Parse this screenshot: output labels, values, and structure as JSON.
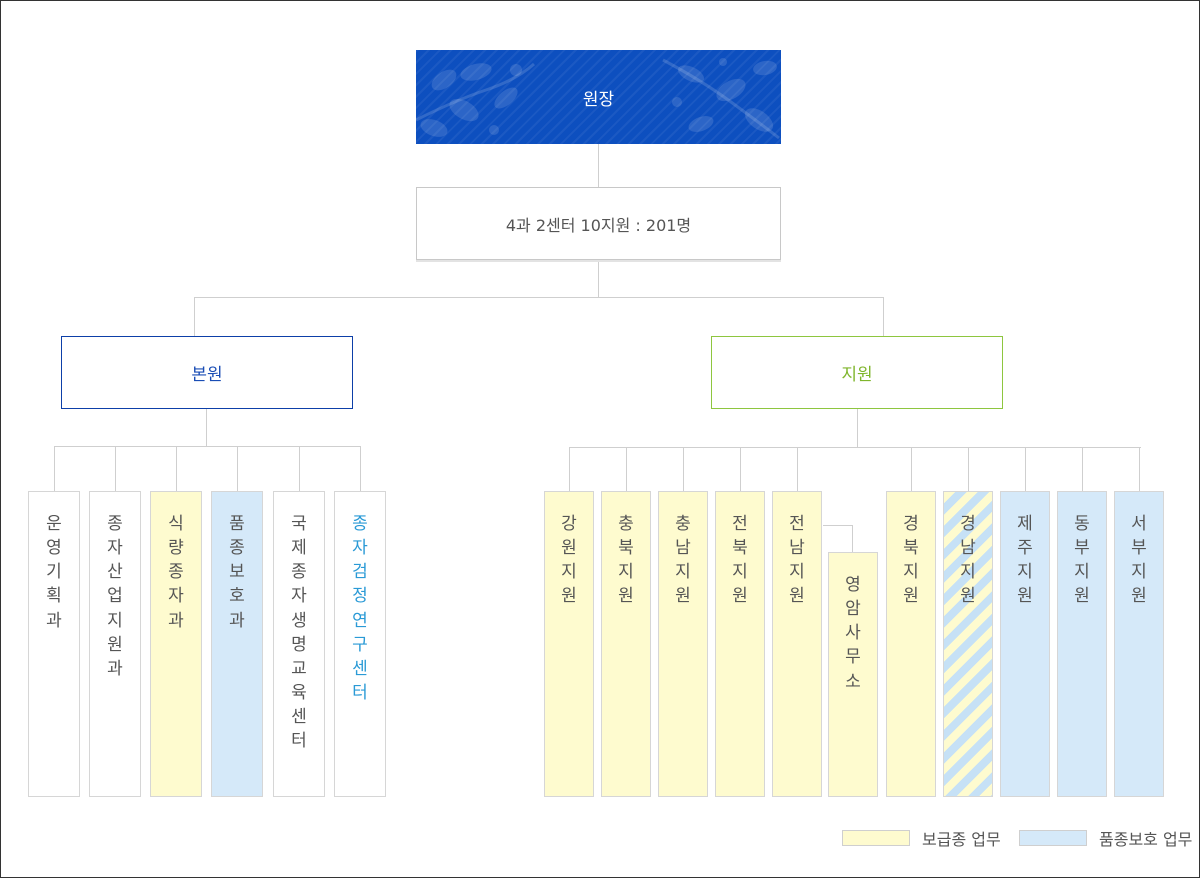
{
  "director": {
    "label": "원장"
  },
  "summary": {
    "label": "4과 2센터 10지원 : 201명"
  },
  "hq": {
    "label": "본원",
    "units": [
      {
        "label": "운영기획과",
        "fill": "none",
        "text": "default"
      },
      {
        "label": "종자산업지원과",
        "fill": "none",
        "text": "default"
      },
      {
        "label": "식량종자과",
        "fill": "yellow",
        "text": "default"
      },
      {
        "label": "품종보호과",
        "fill": "blue",
        "text": "default"
      },
      {
        "label": "국제종자생명교육센터",
        "fill": "none",
        "text": "default"
      },
      {
        "label": "종자검정연구센터",
        "fill": "none",
        "text": "blue"
      }
    ]
  },
  "branches": {
    "label": "지원",
    "units": [
      {
        "label": "강원지원",
        "fill": "yellow"
      },
      {
        "label": "충북지원",
        "fill": "yellow"
      },
      {
        "label": "충남지원",
        "fill": "yellow"
      },
      {
        "label": "전북지원",
        "fill": "yellow"
      },
      {
        "label": "전남지원",
        "fill": "yellow"
      },
      {
        "label": "경북지원",
        "fill": "yellow"
      },
      {
        "label": "경남지원",
        "fill": "stripe"
      },
      {
        "label": "제주지원",
        "fill": "blue"
      },
      {
        "label": "동부지원",
        "fill": "blue"
      },
      {
        "label": "서부지원",
        "fill": "blue"
      }
    ],
    "sub_office": {
      "label": "영암사무소",
      "fill": "yellow",
      "parent": "전남지원"
    }
  },
  "legend": [
    {
      "label": "보급종 업무",
      "color": "#fefbcf"
    },
    {
      "label": "품종보호 업무",
      "color": "#d5e9f9"
    }
  ],
  "colors": {
    "director_bg": "#0d4fbf",
    "hq_border": "#0d3fa8",
    "branch_border": "#8ec63f",
    "yellow_fill": "#fefbcf",
    "blue_fill": "#d5e9f9",
    "connector": "#cfcfcf"
  }
}
